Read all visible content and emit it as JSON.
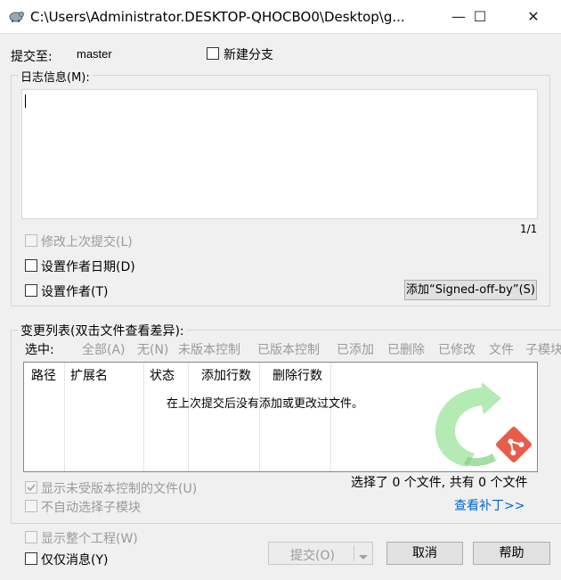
{
  "window": {
    "title": "C:\\Users\\Administrator.DESKTOP-QHOCBO0\\Desktop\\g...",
    "minimize_glyph": "—",
    "maximize_glyph": "☐",
    "close_glyph": "✕"
  },
  "commit_to": {
    "label": "提交至:",
    "branch": "master"
  },
  "new_branch": {
    "label": "新建分支",
    "checked": false
  },
  "log": {
    "group_label": "日志信息(M):",
    "message": "",
    "position": "1/1"
  },
  "options": {
    "amend": {
      "label": "修改上次提交(L)",
      "disabled": true
    },
    "set_author_date": {
      "label": "设置作者日期(D)"
    },
    "set_author": {
      "label": "设置作者(T)"
    },
    "signed_off_button": "添加“Signed-off-by”(S)"
  },
  "changes": {
    "group_label": "变更列表(双击文件查看差异):",
    "select_label": "选中:",
    "filters": [
      "全部(A)",
      "无(N)",
      "未版本控制",
      "已版本控制",
      "已添加",
      "已删除",
      "已修改",
      "文件",
      "子模块"
    ],
    "columns": [
      "路径",
      "扩展名",
      "状态",
      "添加行数",
      "删除行数"
    ],
    "empty_message": "在上次提交后没有添加或更改过文件。",
    "summary": "选择了 0 个文件, 共有 0 个文件",
    "view_patch": "查看补丁>>"
  },
  "list_options": {
    "show_unversioned": "显示未受版本控制的文件(U)",
    "no_auto_submodule": "不自动选择子模块"
  },
  "bottom": {
    "show_whole_project": "显示整个工程(W)",
    "message_only": "仅仅消息(Y)",
    "commit_button": "提交(O)",
    "cancel_button": "取消",
    "help_button": "帮助"
  },
  "colors": {
    "link": "#0066cc",
    "disabled": "#9a9a9a",
    "logo_green": "#9be39b",
    "logo_red": "#e85d4a"
  },
  "icons": [
    "tortoise-git-icon",
    "git-logo-watermark",
    "dropdown-arrow-icon"
  ]
}
